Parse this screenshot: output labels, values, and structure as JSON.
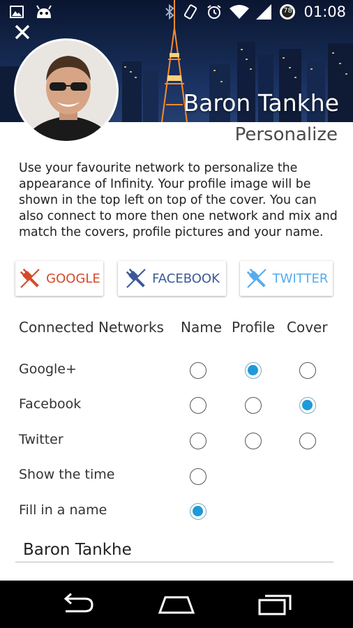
{
  "status_bar": {
    "time": "01:08",
    "battery": "78",
    "icons": [
      "image-icon",
      "android-icon",
      "bluetooth-icon",
      "vibrate-icon",
      "alarm-icon",
      "wifi-icon",
      "signal-icon",
      "battery-icon"
    ]
  },
  "header": {
    "close_icon": "close-icon",
    "profile_name": "Baron Tankhe",
    "section_title": "Personalize"
  },
  "description": "Use your favourite network to personalize the appearance of Infinity. Your profile image will be shown in the top left on top of the cover. You can also connect to more then one network and mix and match the covers, profile pictures and your name.",
  "network_buttons": [
    {
      "label": "GOOGLE",
      "icon": "plug-icon",
      "color": "#d44a2b"
    },
    {
      "label": "FACEBOOK",
      "icon": "plug-icon",
      "color": "#3b5998"
    },
    {
      "label": "TWITTER",
      "icon": "plug-icon",
      "color": "#55acee"
    }
  ],
  "table": {
    "headers": [
      "Connected Networks",
      "Name",
      "Profile",
      "Cover"
    ],
    "rows": [
      {
        "label": "Google+",
        "name": false,
        "profile": true,
        "cover": false
      },
      {
        "label": "Facebook",
        "name": false,
        "profile": false,
        "cover": true
      },
      {
        "label": "Twitter",
        "name": false,
        "profile": false,
        "cover": false
      },
      {
        "label": "Show the time",
        "name": false
      },
      {
        "label": "Fill in a name",
        "name": true
      }
    ]
  },
  "name_field": {
    "value": "Baron Tankhe"
  },
  "colors": {
    "accent": "#1e9ad8",
    "navbar": "#000000"
  },
  "nav_bar": {
    "icons": [
      "back-icon",
      "home-icon",
      "recents-icon"
    ]
  }
}
